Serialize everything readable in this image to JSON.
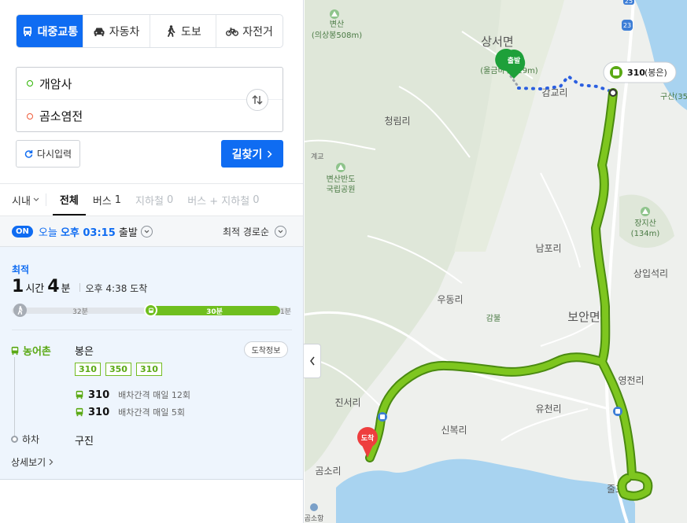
{
  "modes": [
    {
      "label": "대중교통",
      "icon": "bus-icon",
      "active": true
    },
    {
      "label": "자동차",
      "icon": "car-icon",
      "active": false
    },
    {
      "label": "도보",
      "icon": "walk-icon",
      "active": false
    },
    {
      "label": "자전거",
      "icon": "bicycle-icon",
      "active": false
    }
  ],
  "search": {
    "start": "개암사",
    "end": "곰소염전",
    "reset_label": "다시입력",
    "submit_label": "길찾기"
  },
  "filters": {
    "area": "시내",
    "tabs": [
      {
        "label": "전체",
        "count": "",
        "active": true
      },
      {
        "label": "버스",
        "count": "1",
        "active": false
      },
      {
        "label": "지하철",
        "count": "0",
        "active": false
      },
      {
        "label": "버스 + 지하철",
        "count": "0",
        "active": false
      }
    ]
  },
  "time": {
    "on": "ON",
    "day": "오늘",
    "time": "오후 03:15",
    "suffix": "출발",
    "sort": "최적 경로순"
  },
  "result": {
    "badge": "최적",
    "hours": "1",
    "hours_unit": "시간",
    "minutes": "4",
    "minutes_unit": "분",
    "arrival": "오후 4:38 도착",
    "bar": {
      "walk": "32분",
      "bus": "30분",
      "end": "1분"
    },
    "board_label": "농어촌",
    "board_stop": "봉은",
    "info_button": "도착정보",
    "route_chips": [
      "310",
      "350",
      "310"
    ],
    "services": [
      {
        "route": "310",
        "text": "배차간격 매일 12회"
      },
      {
        "route": "310",
        "text": "배차간격 매일 5회"
      }
    ],
    "alight_label": "하차",
    "alight_stop": "구진",
    "detail_link": "상세보기"
  },
  "map": {
    "labels": {
      "peak1": "변산",
      "peak1_sub": "(의상봉508m)",
      "sangseo": "상서면",
      "start_sub": "(울금바위329m)",
      "gamgyo": "감교리",
      "cheongnim": "청림리",
      "park": "변산반도",
      "park_sub": "국립공원",
      "jangji": "장지산",
      "jangji_sub": "(134m)",
      "nampo": "남포리",
      "sangip": "상입석리",
      "udong": "우동리",
      "boan": "보안면",
      "gambul": "감불",
      "yeongjeon": "영전리",
      "jinseo": "진서리",
      "yucheon": "유천리",
      "sinbok": "신복리",
      "gomso": "곰소리",
      "gomsohang": "곰소항",
      "jul": "줄포",
      "gusan": "구산(35",
      "gye": "계교",
      "road23": "23",
      "road25": "25"
    },
    "start_marker": "출발",
    "end_marker": "도착",
    "bus_stop_label": "310",
    "bus_stop_sub": "(봉은)"
  }
}
